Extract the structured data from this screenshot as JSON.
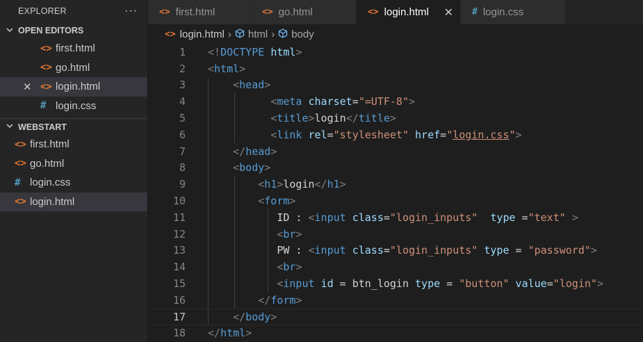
{
  "explorer": {
    "title": "EXPLORER",
    "more": "···",
    "open_editors": {
      "label": "OPEN EDITORS",
      "files": [
        {
          "name": "first.html",
          "type": "html"
        },
        {
          "name": "go.html",
          "type": "html"
        },
        {
          "name": "login.html",
          "type": "html",
          "active": true
        },
        {
          "name": "login.css",
          "type": "css"
        }
      ]
    },
    "workspace": {
      "label": "WEBSTART",
      "files": [
        {
          "name": "first.html",
          "type": "html"
        },
        {
          "name": "go.html",
          "type": "html"
        },
        {
          "name": "login.css",
          "type": "css"
        },
        {
          "name": "login.html",
          "type": "html",
          "selected": true
        }
      ]
    }
  },
  "tabs": [
    {
      "label": "first.html",
      "type": "html"
    },
    {
      "label": "go.html",
      "type": "html"
    },
    {
      "label": "login.html",
      "type": "html",
      "active": true
    },
    {
      "label": "login.css",
      "type": "css"
    }
  ],
  "breadcrumb": {
    "file": "login.html",
    "items": [
      "html",
      "body"
    ]
  },
  "editor": {
    "current_line": 17,
    "lines": [
      {
        "n": "1",
        "tokens": [
          [
            "br",
            "<!"
          ],
          [
            "tag",
            "DOCTYPE"
          ],
          [
            "txt",
            " "
          ],
          [
            "attr",
            "html"
          ],
          [
            "br",
            ">"
          ]
        ]
      },
      {
        "n": "2",
        "tokens": [
          [
            "br",
            "<"
          ],
          [
            "tag",
            "html"
          ],
          [
            "br",
            ">"
          ]
        ]
      },
      {
        "n": "3",
        "tokens": [
          [
            "txt",
            "    "
          ],
          [
            "br",
            "<"
          ],
          [
            "tag",
            "head"
          ],
          [
            "br",
            ">"
          ]
        ]
      },
      {
        "n": "4",
        "tokens": [
          [
            "txt",
            "          "
          ],
          [
            "br",
            "<"
          ],
          [
            "tag",
            "meta"
          ],
          [
            "txt",
            " "
          ],
          [
            "attr",
            "charset"
          ],
          [
            "txt",
            "="
          ],
          [
            "str",
            "\"=UTF-8\""
          ],
          [
            "br",
            ">"
          ]
        ]
      },
      {
        "n": "5",
        "tokens": [
          [
            "txt",
            "          "
          ],
          [
            "br",
            "<"
          ],
          [
            "tag",
            "title"
          ],
          [
            "br",
            ">"
          ],
          [
            "txt",
            "login"
          ],
          [
            "br",
            "</"
          ],
          [
            "tag",
            "title"
          ],
          [
            "br",
            ">"
          ]
        ]
      },
      {
        "n": "6",
        "tokens": [
          [
            "txt",
            "          "
          ],
          [
            "br",
            "<"
          ],
          [
            "tag",
            "link"
          ],
          [
            "txt",
            " "
          ],
          [
            "attr",
            "rel"
          ],
          [
            "txt",
            "="
          ],
          [
            "str",
            "\"stylesheet\""
          ],
          [
            "txt",
            " "
          ],
          [
            "attr",
            "href"
          ],
          [
            "txt",
            "="
          ],
          [
            "str",
            "\""
          ],
          [
            "link",
            "login.css"
          ],
          [
            "str",
            "\""
          ],
          [
            "br",
            ">"
          ]
        ]
      },
      {
        "n": "7",
        "tokens": [
          [
            "txt",
            "    "
          ],
          [
            "br",
            "</"
          ],
          [
            "tag",
            "head"
          ],
          [
            "br",
            ">"
          ]
        ]
      },
      {
        "n": "8",
        "tokens": [
          [
            "txt",
            "    "
          ],
          [
            "br",
            "<"
          ],
          [
            "tag",
            "body"
          ],
          [
            "br",
            ">"
          ]
        ]
      },
      {
        "n": "9",
        "tokens": [
          [
            "txt",
            "        "
          ],
          [
            "br",
            "<"
          ],
          [
            "tag",
            "h1"
          ],
          [
            "br",
            ">"
          ],
          [
            "txt",
            "login"
          ],
          [
            "br",
            "</"
          ],
          [
            "tag",
            "h1"
          ],
          [
            "br",
            ">"
          ]
        ]
      },
      {
        "n": "10",
        "tokens": [
          [
            "txt",
            "        "
          ],
          [
            "br",
            "<"
          ],
          [
            "tag",
            "form"
          ],
          [
            "br",
            ">"
          ]
        ]
      },
      {
        "n": "11",
        "tokens": [
          [
            "txt",
            "           ID : "
          ],
          [
            "br",
            "<"
          ],
          [
            "tag",
            "input"
          ],
          [
            "txt",
            " "
          ],
          [
            "attr",
            "class"
          ],
          [
            "txt",
            "="
          ],
          [
            "str",
            "\"login_inputs\""
          ],
          [
            "txt",
            "  "
          ],
          [
            "attr",
            "type"
          ],
          [
            "txt",
            " ="
          ],
          [
            "str",
            "\"text\""
          ],
          [
            "txt",
            " "
          ],
          [
            "br",
            ">"
          ]
        ]
      },
      {
        "n": "12",
        "tokens": [
          [
            "txt",
            "           "
          ],
          [
            "br",
            "<"
          ],
          [
            "tag",
            "br"
          ],
          [
            "br",
            ">"
          ]
        ]
      },
      {
        "n": "13",
        "tokens": [
          [
            "txt",
            "           PW : "
          ],
          [
            "br",
            "<"
          ],
          [
            "tag",
            "input"
          ],
          [
            "txt",
            " "
          ],
          [
            "attr",
            "class"
          ],
          [
            "txt",
            "="
          ],
          [
            "str",
            "\"login_inputs\""
          ],
          [
            "txt",
            " "
          ],
          [
            "attr",
            "type"
          ],
          [
            "txt",
            " = "
          ],
          [
            "str",
            "\"password\""
          ],
          [
            "br",
            ">"
          ]
        ]
      },
      {
        "n": "14",
        "tokens": [
          [
            "txt",
            "           "
          ],
          [
            "br",
            "<"
          ],
          [
            "tag",
            "br"
          ],
          [
            "br",
            ">"
          ]
        ]
      },
      {
        "n": "15",
        "tokens": [
          [
            "txt",
            "           "
          ],
          [
            "br",
            "<"
          ],
          [
            "tag",
            "input"
          ],
          [
            "txt",
            " "
          ],
          [
            "attr",
            "id"
          ],
          [
            "txt",
            " = btn_login "
          ],
          [
            "attr",
            "type"
          ],
          [
            "txt",
            " = "
          ],
          [
            "str",
            "\"button\""
          ],
          [
            "txt",
            " "
          ],
          [
            "attr",
            "value"
          ],
          [
            "txt",
            "="
          ],
          [
            "str",
            "\"login\""
          ],
          [
            "br",
            ">"
          ]
        ]
      },
      {
        "n": "16",
        "tokens": [
          [
            "txt",
            "        "
          ],
          [
            "br",
            "</"
          ],
          [
            "tag",
            "form"
          ],
          [
            "br",
            ">"
          ]
        ]
      },
      {
        "n": "17",
        "tokens": [
          [
            "txt",
            "    "
          ],
          [
            "br",
            "</"
          ],
          [
            "tag",
            "body"
          ],
          [
            "br",
            ">"
          ]
        ]
      },
      {
        "n": "18",
        "tokens": [
          [
            "br",
            "</"
          ],
          [
            "tag",
            "html"
          ],
          [
            "br",
            ">"
          ]
        ]
      }
    ]
  },
  "icons": {
    "html": "<>",
    "css": "#",
    "close": "✕",
    "chevron_down": "⌄",
    "cube": "⬡",
    "separator": "›"
  },
  "colors": {
    "tag": "#569cd6",
    "attr": "#9cdcfe",
    "string": "#ce9178",
    "bracket": "#808080",
    "text": "#d4d4d4",
    "html_icon": "#e37933",
    "css_icon": "#519aba"
  }
}
